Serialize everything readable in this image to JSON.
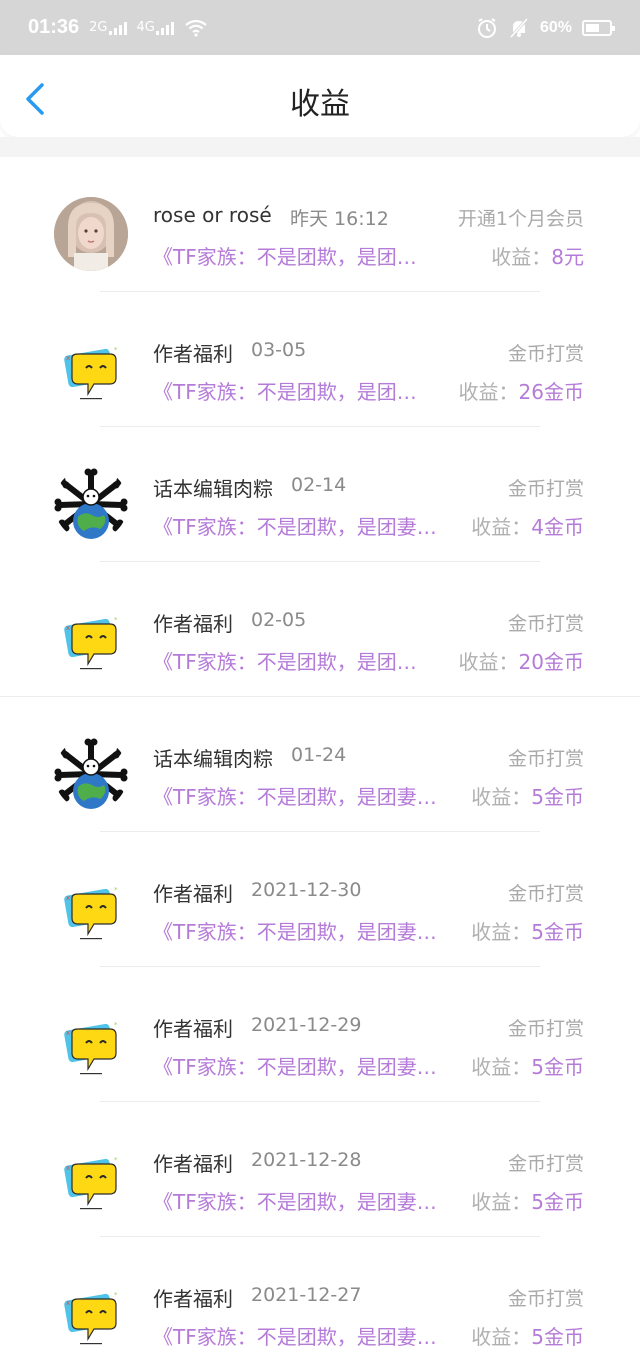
{
  "status_bar": {
    "time": "01:36",
    "net1": "2G",
    "net2": "4G",
    "battery": "60%",
    "battery_level": 0.6
  },
  "header": {
    "title": "收益"
  },
  "earn_label": "收益：",
  "rows": [
    {
      "name": "rose or rosé",
      "date": "昨天 16:12",
      "type": "开通1个月会员",
      "book": "《TF家族：不是团欺，是团…",
      "value": "8元",
      "avatar": "girl-photo"
    },
    {
      "name": "作者福利",
      "date": "03-05",
      "type": "金币打赏",
      "book": "《TF家族：不是团欺，是团…",
      "value": "26金币",
      "avatar": "yellow-chat"
    },
    {
      "name": "话本编辑肉粽",
      "date": "02-14",
      "type": "金币打赏",
      "book": "《TF家族：不是团欺，是团妻…",
      "value": "4金币",
      "avatar": "bone-earth"
    },
    {
      "name": "作者福利",
      "date": "02-05",
      "type": "金币打赏",
      "book": "《TF家族：不是团欺，是团…",
      "value": "20金币",
      "avatar": "yellow-chat"
    },
    {
      "name": "话本编辑肉粽",
      "date": "01-24",
      "type": "金币打赏",
      "book": "《TF家族：不是团欺，是团妻…",
      "value": "5金币",
      "avatar": "bone-earth"
    },
    {
      "name": "作者福利",
      "date": "2021-12-30",
      "type": "金币打赏",
      "book": "《TF家族：不是团欺，是团妻…",
      "value": "5金币",
      "avatar": "yellow-chat"
    },
    {
      "name": "作者福利",
      "date": "2021-12-29",
      "type": "金币打赏",
      "book": "《TF家族：不是团欺，是团妻…",
      "value": "5金币",
      "avatar": "yellow-chat"
    },
    {
      "name": "作者福利",
      "date": "2021-12-28",
      "type": "金币打赏",
      "book": "《TF家族：不是团欺，是团妻…",
      "value": "5金币",
      "avatar": "yellow-chat"
    },
    {
      "name": "作者福利",
      "date": "2021-12-27",
      "type": "金币打赏",
      "book": "《TF家族：不是团欺，是团妻…",
      "value": "5金币",
      "avatar": "yellow-chat"
    }
  ],
  "colors": {
    "accent": "#b57bd8",
    "back": "#2a9af0",
    "status_bg": "#d6d6d6"
  }
}
